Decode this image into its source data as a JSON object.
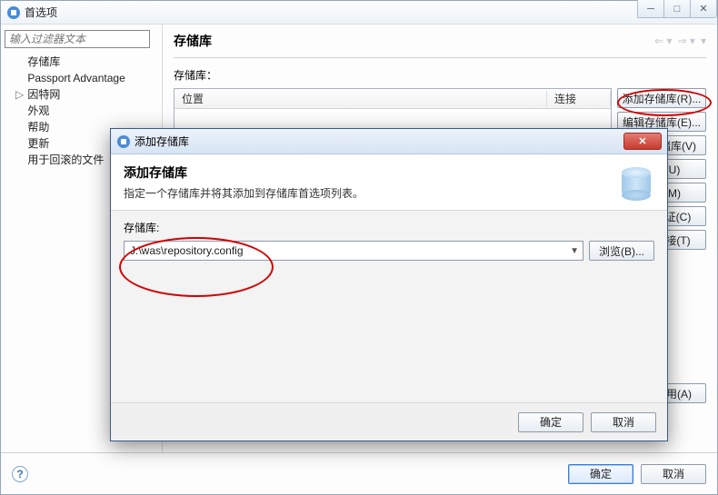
{
  "main_window": {
    "title": "首选项",
    "filter_placeholder": "输入过滤器文本",
    "tree": {
      "items": [
        "存储库",
        "Passport Advantage",
        "因特网",
        "外观",
        "帮助",
        "更新",
        "用于回滚的文件"
      ],
      "expanders": [
        "",
        "",
        "▷",
        "",
        "",
        "",
        ""
      ]
    },
    "right": {
      "title": "存储库",
      "section_label": "存储库：",
      "columns": {
        "location": "位置",
        "connection": "连接"
      },
      "side_buttons": {
        "add": "添加存储库(R)...",
        "edit": "编辑存储库(E)...",
        "remove": "移除存储库(V)",
        "up": "上移(U)",
        "down": "下移(M)",
        "clear": "清除凭证(C)",
        "test": "测试连接(T)"
      },
      "apply": "应用(A)"
    },
    "footer": {
      "ok": "确定",
      "cancel": "取消"
    }
  },
  "dialog": {
    "title": "添加存储库",
    "header_title": "添加存储库",
    "header_desc": "指定一个存储库并将其添加到存储库首选项列表。",
    "field_label": "存储库:",
    "field_value": "J:\\was\\repository.config",
    "browse": "浏览(B)...",
    "ok": "确定",
    "cancel": "取消"
  },
  "icons": {
    "app": "app-icon",
    "help": "?"
  }
}
